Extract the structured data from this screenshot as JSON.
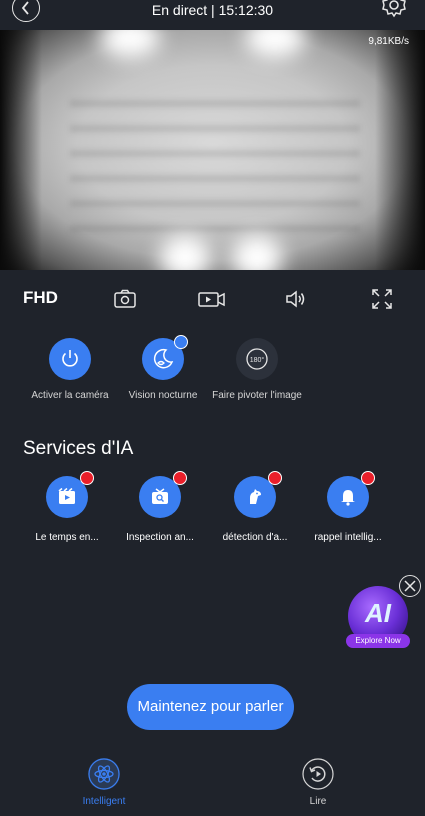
{
  "header": {
    "title": "En direct | 15:12:30",
    "back_icon": "chevron-left-icon",
    "settings_icon": "gear-icon"
  },
  "video": {
    "bitrate": "9,81KB/s"
  },
  "controls": {
    "quality": "FHD",
    "icons": [
      "camera-icon",
      "video-record-icon",
      "speaker-icon",
      "fullscreen-icon"
    ]
  },
  "quick_actions": [
    {
      "label": "Activer la caméra",
      "icon": "power-icon",
      "color": "#3a7ef1"
    },
    {
      "label": "Vision nocturne",
      "icon": "night-vision-icon",
      "color": "#3a7ef1"
    },
    {
      "label": "Faire pivoter l'image",
      "icon": "rotate-180-icon",
      "color": "#2c313b",
      "icon_text": "180°"
    }
  ],
  "ai_services": {
    "title": "Services d'IA",
    "items": [
      {
        "label": "Le temps en...",
        "icon": "timelapse-icon"
      },
      {
        "label": "Inspection an...",
        "icon": "inspection-icon"
      },
      {
        "label": "détection d'a...",
        "icon": "pet-detection-icon"
      },
      {
        "label": "rappel intellig...",
        "icon": "bell-icon"
      }
    ],
    "accent": "#3a7ef1",
    "badge_color": "#ea1f2a"
  },
  "promo": {
    "text": "AI",
    "button": "Explore Now"
  },
  "talk_button": "Maintenez pour parler",
  "tabs": [
    {
      "label": "Intelligent",
      "active": true,
      "color": "#3a7ef1"
    },
    {
      "label": "Lire",
      "active": false,
      "color": "#d6d6d6"
    }
  ]
}
